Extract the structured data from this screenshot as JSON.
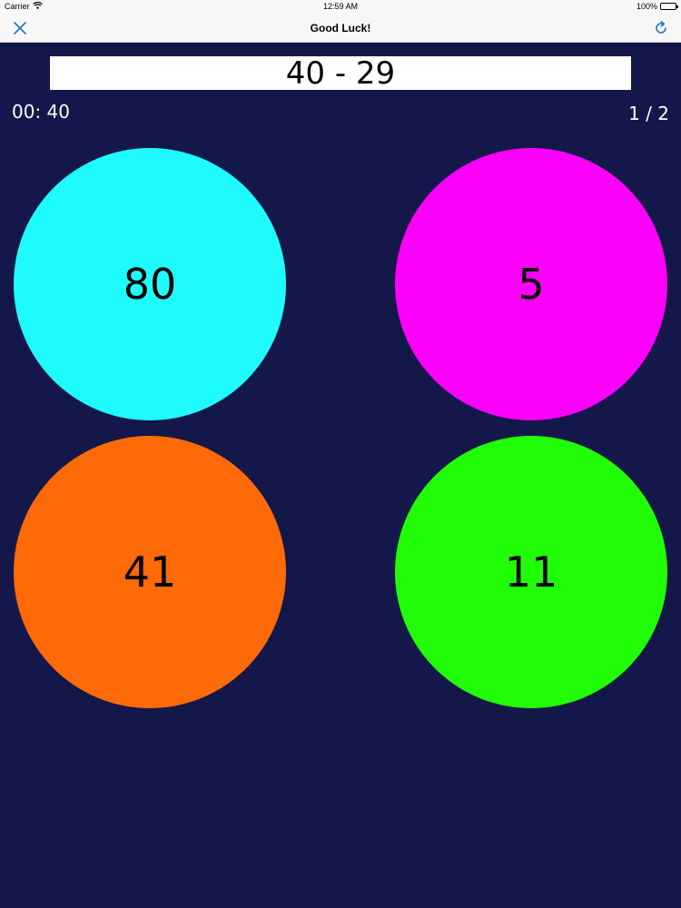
{
  "status_bar": {
    "carrier": "Carrier",
    "time": "12:59 AM",
    "battery": "100%"
  },
  "nav": {
    "title": "Good Luck!",
    "close_icon": "close-icon",
    "refresh_icon": "refresh-icon",
    "accent_color": "#1e73d8"
  },
  "quiz": {
    "question": "40 - 29",
    "timer": "00: 40",
    "progress": "1 / 2",
    "answers": [
      {
        "label": "80",
        "color": "#1ffbfd"
      },
      {
        "label": "5",
        "color": "#fc00f9"
      },
      {
        "label": "41",
        "color": "#fd6a07"
      },
      {
        "label": "11",
        "color": "#21fd07"
      }
    ]
  },
  "colors": {
    "background": "#13174a",
    "bar_background": "#f7f7f7"
  }
}
